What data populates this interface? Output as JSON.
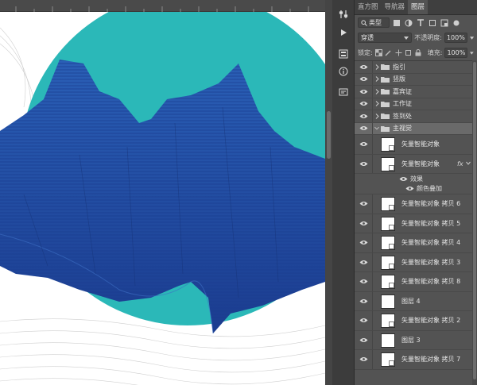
{
  "tabs": [
    {
      "label": "直方图",
      "active": false
    },
    {
      "label": "导航器",
      "active": false
    },
    {
      "label": "图层",
      "active": true
    }
  ],
  "filter": {
    "kind_label": "类型"
  },
  "blend": {
    "mode": "穿透",
    "opacity_label": "不透明度:",
    "opacity_value": "100%"
  },
  "lock": {
    "label": "锁定:",
    "fill_label": "填充:",
    "fill_value": "100%"
  },
  "groups": [
    {
      "name": "指引",
      "expanded": false
    },
    {
      "name": "竖版",
      "expanded": false
    },
    {
      "name": "嘉宾证",
      "expanded": false
    },
    {
      "name": "工作证",
      "expanded": false
    },
    {
      "name": "签到处",
      "expanded": false
    },
    {
      "name": "主视觉",
      "expanded": true
    }
  ],
  "layers": [
    {
      "name": "矢量智能对象",
      "smart_object": true
    },
    {
      "name": "矢量智能对象",
      "smart_object": true,
      "has_fx": true,
      "fx_label": "fx"
    },
    {
      "name": "矢量智能对象 拷贝 6",
      "smart_object": true
    },
    {
      "name": "矢量智能对象 拷贝 5",
      "smart_object": true
    },
    {
      "name": "矢量智能对象 拷贝 4",
      "smart_object": true
    },
    {
      "name": "矢量智能对象 拷贝 3",
      "smart_object": true
    },
    {
      "name": "矢量智能对象 拷贝 8",
      "smart_object": true
    },
    {
      "name": "图层 4",
      "smart_object": false
    },
    {
      "name": "矢量智能对象 拷贝 2",
      "smart_object": true
    },
    {
      "name": "图层 3",
      "smart_object": false
    },
    {
      "name": "矢量智能对象 拷贝 7",
      "smart_object": true
    }
  ],
  "effects": {
    "label": "效果",
    "color_overlay": "颜色叠加"
  },
  "colors": {
    "circle": "#2bb8b8",
    "mountain_light": "#2a5fb6",
    "mountain_dark": "#1b3c8f",
    "panel_bg": "#535353",
    "selected_row": "#6a6a6a"
  },
  "icons": [
    "eye-icon",
    "folder-icon",
    "chevron-right-icon",
    "chevron-down-icon",
    "filter-icon",
    "lock-icon",
    "fx-icon",
    "play-icon",
    "info-icon",
    "adjustments-icon",
    "swatches-icon"
  ]
}
